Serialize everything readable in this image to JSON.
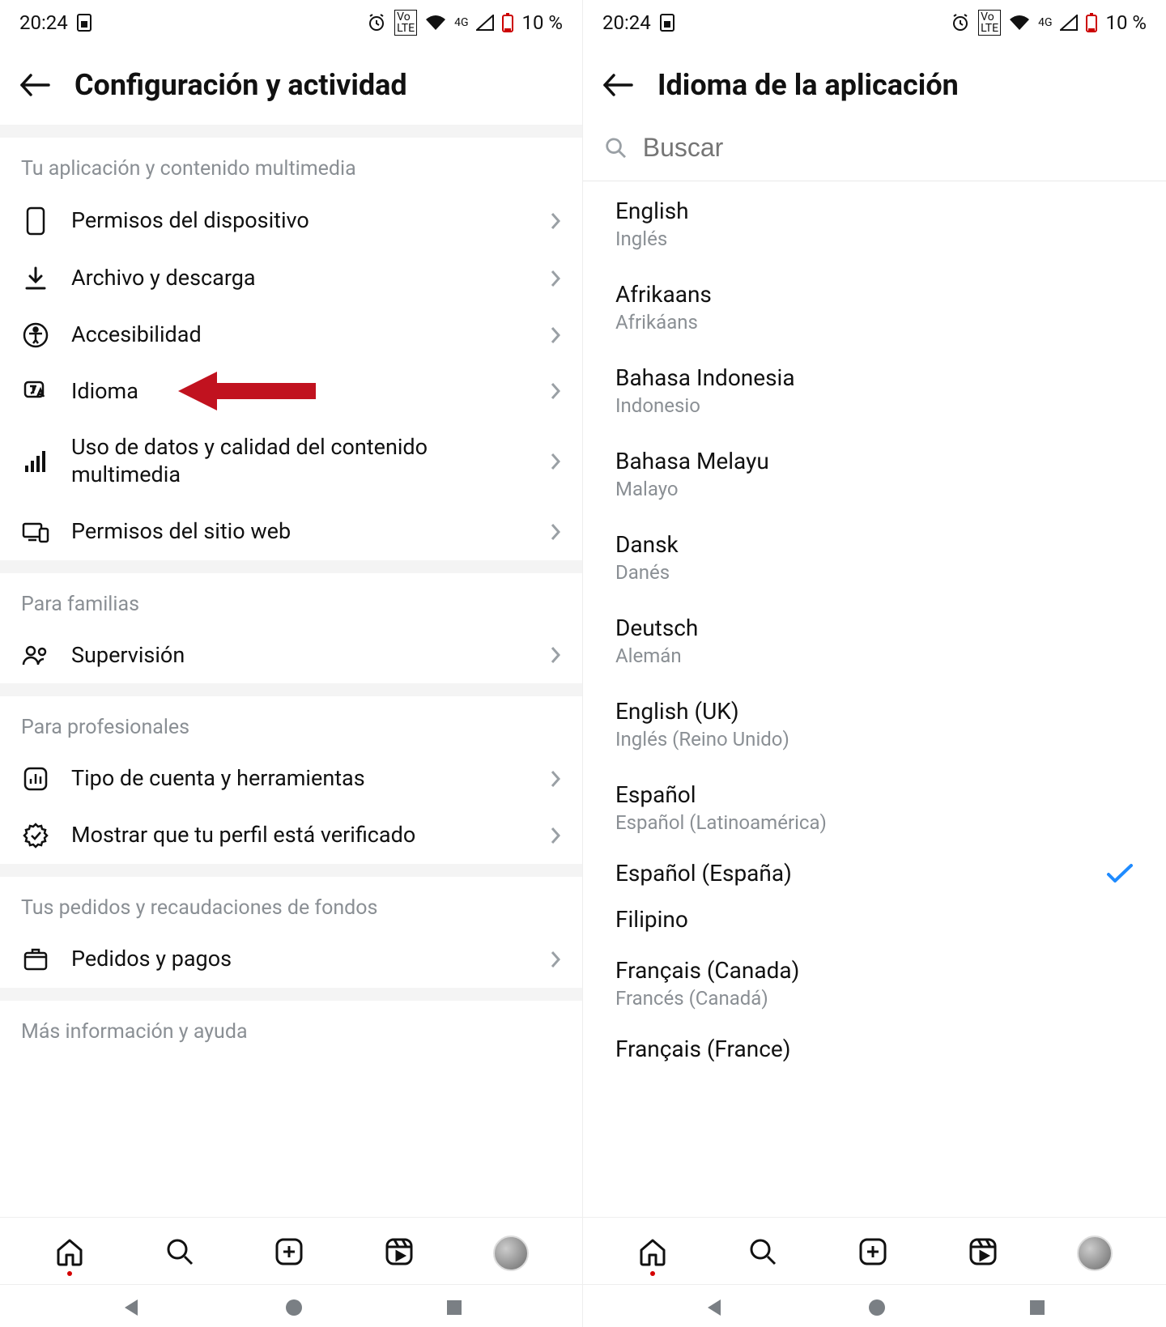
{
  "status": {
    "time": "20:24",
    "battery": "10 %"
  },
  "left": {
    "title": "Configuración y actividad",
    "section1": "Tu aplicación y contenido multimedia",
    "items1": [
      "Permisos del dispositivo",
      "Archivo y descarga",
      "Accesibilidad",
      "Idioma",
      "Uso de datos y calidad del contenido multimedia",
      "Permisos del sitio web"
    ],
    "section2": "Para familias",
    "items2": [
      "Supervisión"
    ],
    "section3": "Para profesionales",
    "items3": [
      "Tipo de cuenta y herramientas",
      "Mostrar que tu perfil está verificado"
    ],
    "section4": "Tus pedidos y recaudaciones de fondos",
    "items4": [
      "Pedidos y pagos"
    ],
    "section5": "Más información y ayuda"
  },
  "right": {
    "title": "Idioma de la aplicación",
    "search_placeholder": "Buscar",
    "languages": [
      {
        "native": "English",
        "local": "Inglés",
        "selected": false
      },
      {
        "native": "Afrikaans",
        "local": "Afrikáans",
        "selected": false
      },
      {
        "native": "Bahasa Indonesia",
        "local": "Indonesio",
        "selected": false
      },
      {
        "native": "Bahasa Melayu",
        "local": "Malayo",
        "selected": false
      },
      {
        "native": "Dansk",
        "local": "Danés",
        "selected": false
      },
      {
        "native": "Deutsch",
        "local": "Alemán",
        "selected": false
      },
      {
        "native": "English (UK)",
        "local": "Inglés (Reino Unido)",
        "selected": false
      },
      {
        "native": "Español",
        "local": "Español (Latinoamérica)",
        "selected": false
      },
      {
        "native": "Español (España)",
        "local": "",
        "selected": true
      },
      {
        "native": "Filipino",
        "local": "",
        "selected": false
      },
      {
        "native": "Français (Canada)",
        "local": "Francés (Canadá)",
        "selected": false
      },
      {
        "native": "Français (France)",
        "local": "",
        "selected": false
      }
    ]
  }
}
